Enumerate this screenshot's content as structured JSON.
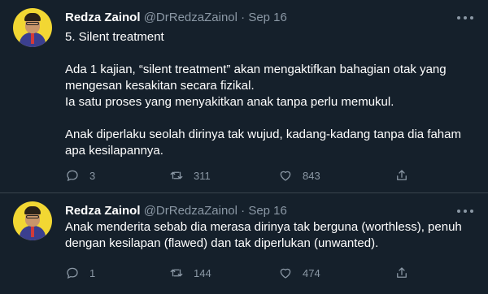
{
  "tweets": [
    {
      "name": "Redza Zainol",
      "handle": "@DrRedzaZainol",
      "separator": "·",
      "date": "Sep 16",
      "text": "5. Silent treatment\n\nAda 1 kajian, “silent treatment” akan mengaktifkan bahagian otak yang\nmengesan kesakitan secara fizikal.\nIa satu proses yang menyakitkan anak tanpa perlu memukul.\n\nAnak diperlaku seolah dirinya tak wujud, kadang-kadang tanpa dia faham\napa kesilapannya.",
      "replies": "3",
      "retweets": "311",
      "likes": "843"
    },
    {
      "name": "Redza Zainol",
      "handle": "@DrRedzaZainol",
      "separator": "·",
      "date": "Sep 16",
      "text": "Anak menderita sebab dia merasa dirinya tak berguna (worthless), penuh\ndengan kesilapan (flawed) dan tak diperlukan (unwanted).",
      "replies": "1",
      "retweets": "144",
      "likes": "474"
    }
  ],
  "icons": {
    "reply": "reply-icon",
    "retweet": "retweet-icon",
    "like": "heart-icon",
    "share": "share-icon",
    "more": "more-icon"
  },
  "colors": {
    "background": "#15202b",
    "text": "#ffffff",
    "muted": "#8b98a5",
    "divider": "#38444d",
    "avatar_bg": "#f2d733"
  }
}
